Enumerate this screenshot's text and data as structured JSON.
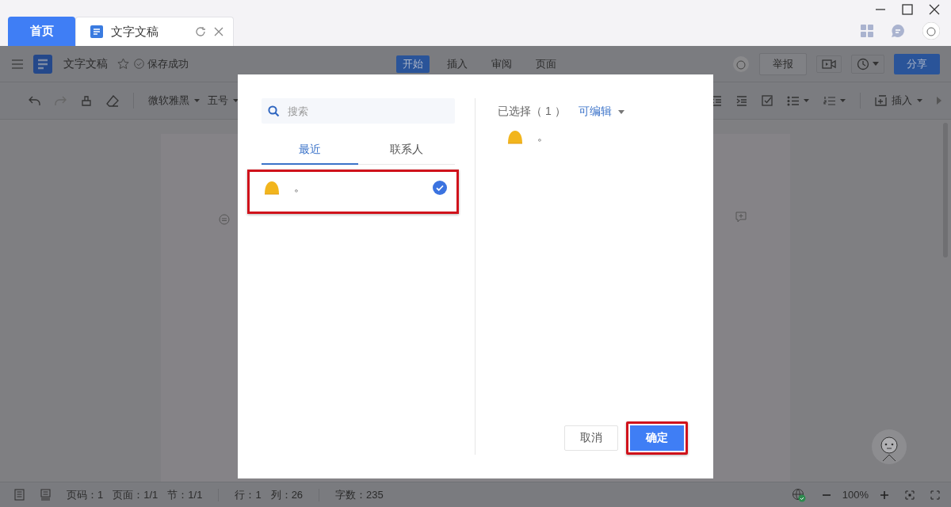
{
  "window_tabs": [
    {
      "label": "首页",
      "kind": "home"
    },
    {
      "label": "文字文稿",
      "kind": "doc"
    }
  ],
  "header": {
    "doc_title": "文字文稿",
    "save_status": "保存成功",
    "tabs": [
      {
        "label": "开始",
        "selected": true
      },
      {
        "label": "插入",
        "selected": false
      },
      {
        "label": "审阅",
        "selected": false
      },
      {
        "label": "页面",
        "selected": false
      }
    ],
    "report_button": "举报",
    "share_button": "分享"
  },
  "toolbar": {
    "font": "微软雅黑",
    "size": "五号",
    "insert": "插入"
  },
  "dialog": {
    "search": {
      "placeholder": "搜索"
    },
    "tabs": [
      {
        "label": "最近",
        "selected": true
      },
      {
        "label": "联系人",
        "selected": false
      }
    ],
    "contacts": [
      {
        "name": "。",
        "checked": true,
        "highlighted": true
      }
    ],
    "selected_label": "已选择（ 1 ）",
    "permission": "可编辑",
    "selected_people": [
      {
        "name": "。"
      }
    ],
    "buttons": [
      {
        "label": "取消",
        "kind": "secondary",
        "highlighted": false
      },
      {
        "label": "确定",
        "kind": "primary",
        "highlighted": true
      }
    ]
  },
  "status_bar": {
    "groups": [
      [
        "页码：1",
        "页面：1/1",
        "节：1/1"
      ],
      [
        "行：1",
        "列：26"
      ],
      [
        "字数：235"
      ]
    ],
    "zoom": "100%"
  }
}
